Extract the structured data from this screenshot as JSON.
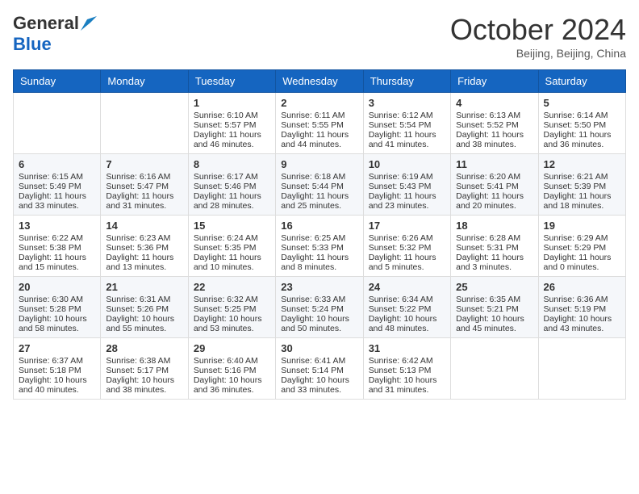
{
  "header": {
    "logo": {
      "general": "General",
      "blue": "Blue"
    },
    "title": "October 2024",
    "subtitle": "Beijing, Beijing, China"
  },
  "days_of_week": [
    "Sunday",
    "Monday",
    "Tuesday",
    "Wednesday",
    "Thursday",
    "Friday",
    "Saturday"
  ],
  "weeks": [
    [
      {
        "day": null,
        "data": null
      },
      {
        "day": null,
        "data": null
      },
      {
        "day": "1",
        "data": "Sunrise: 6:10 AM\nSunset: 5:57 PM\nDaylight: 11 hours and 46 minutes."
      },
      {
        "day": "2",
        "data": "Sunrise: 6:11 AM\nSunset: 5:55 PM\nDaylight: 11 hours and 44 minutes."
      },
      {
        "day": "3",
        "data": "Sunrise: 6:12 AM\nSunset: 5:54 PM\nDaylight: 11 hours and 41 minutes."
      },
      {
        "day": "4",
        "data": "Sunrise: 6:13 AM\nSunset: 5:52 PM\nDaylight: 11 hours and 38 minutes."
      },
      {
        "day": "5",
        "data": "Sunrise: 6:14 AM\nSunset: 5:50 PM\nDaylight: 11 hours and 36 minutes."
      }
    ],
    [
      {
        "day": "6",
        "data": "Sunrise: 6:15 AM\nSunset: 5:49 PM\nDaylight: 11 hours and 33 minutes."
      },
      {
        "day": "7",
        "data": "Sunrise: 6:16 AM\nSunset: 5:47 PM\nDaylight: 11 hours and 31 minutes."
      },
      {
        "day": "8",
        "data": "Sunrise: 6:17 AM\nSunset: 5:46 PM\nDaylight: 11 hours and 28 minutes."
      },
      {
        "day": "9",
        "data": "Sunrise: 6:18 AM\nSunset: 5:44 PM\nDaylight: 11 hours and 25 minutes."
      },
      {
        "day": "10",
        "data": "Sunrise: 6:19 AM\nSunset: 5:43 PM\nDaylight: 11 hours and 23 minutes."
      },
      {
        "day": "11",
        "data": "Sunrise: 6:20 AM\nSunset: 5:41 PM\nDaylight: 11 hours and 20 minutes."
      },
      {
        "day": "12",
        "data": "Sunrise: 6:21 AM\nSunset: 5:39 PM\nDaylight: 11 hours and 18 minutes."
      }
    ],
    [
      {
        "day": "13",
        "data": "Sunrise: 6:22 AM\nSunset: 5:38 PM\nDaylight: 11 hours and 15 minutes."
      },
      {
        "day": "14",
        "data": "Sunrise: 6:23 AM\nSunset: 5:36 PM\nDaylight: 11 hours and 13 minutes."
      },
      {
        "day": "15",
        "data": "Sunrise: 6:24 AM\nSunset: 5:35 PM\nDaylight: 11 hours and 10 minutes."
      },
      {
        "day": "16",
        "data": "Sunrise: 6:25 AM\nSunset: 5:33 PM\nDaylight: 11 hours and 8 minutes."
      },
      {
        "day": "17",
        "data": "Sunrise: 6:26 AM\nSunset: 5:32 PM\nDaylight: 11 hours and 5 minutes."
      },
      {
        "day": "18",
        "data": "Sunrise: 6:28 AM\nSunset: 5:31 PM\nDaylight: 11 hours and 3 minutes."
      },
      {
        "day": "19",
        "data": "Sunrise: 6:29 AM\nSunset: 5:29 PM\nDaylight: 11 hours and 0 minutes."
      }
    ],
    [
      {
        "day": "20",
        "data": "Sunrise: 6:30 AM\nSunset: 5:28 PM\nDaylight: 10 hours and 58 minutes."
      },
      {
        "day": "21",
        "data": "Sunrise: 6:31 AM\nSunset: 5:26 PM\nDaylight: 10 hours and 55 minutes."
      },
      {
        "day": "22",
        "data": "Sunrise: 6:32 AM\nSunset: 5:25 PM\nDaylight: 10 hours and 53 minutes."
      },
      {
        "day": "23",
        "data": "Sunrise: 6:33 AM\nSunset: 5:24 PM\nDaylight: 10 hours and 50 minutes."
      },
      {
        "day": "24",
        "data": "Sunrise: 6:34 AM\nSunset: 5:22 PM\nDaylight: 10 hours and 48 minutes."
      },
      {
        "day": "25",
        "data": "Sunrise: 6:35 AM\nSunset: 5:21 PM\nDaylight: 10 hours and 45 minutes."
      },
      {
        "day": "26",
        "data": "Sunrise: 6:36 AM\nSunset: 5:19 PM\nDaylight: 10 hours and 43 minutes."
      }
    ],
    [
      {
        "day": "27",
        "data": "Sunrise: 6:37 AM\nSunset: 5:18 PM\nDaylight: 10 hours and 40 minutes."
      },
      {
        "day": "28",
        "data": "Sunrise: 6:38 AM\nSunset: 5:17 PM\nDaylight: 10 hours and 38 minutes."
      },
      {
        "day": "29",
        "data": "Sunrise: 6:40 AM\nSunset: 5:16 PM\nDaylight: 10 hours and 36 minutes."
      },
      {
        "day": "30",
        "data": "Sunrise: 6:41 AM\nSunset: 5:14 PM\nDaylight: 10 hours and 33 minutes."
      },
      {
        "day": "31",
        "data": "Sunrise: 6:42 AM\nSunset: 5:13 PM\nDaylight: 10 hours and 31 minutes."
      },
      {
        "day": null,
        "data": null
      },
      {
        "day": null,
        "data": null
      }
    ]
  ]
}
